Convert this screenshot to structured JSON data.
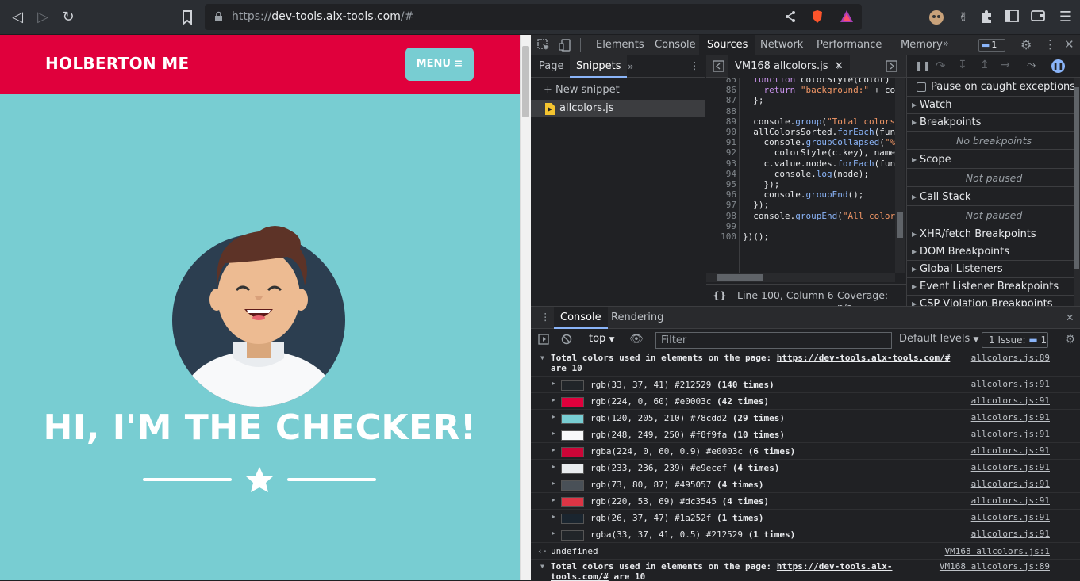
{
  "browser": {
    "url_prefix": "https://",
    "url_host": "dev-tools.alx-tools.com",
    "url_path": "/#"
  },
  "page": {
    "brand": "HOLBERTON ME",
    "menu_label": "MENU ≡",
    "hero_title": "HI, I'M THE CHECKER!",
    "colors": {
      "navbar": "#e0003c",
      "background": "#78cdd2",
      "text": "#ffffff"
    }
  },
  "devtools": {
    "tabs": [
      "Elements",
      "Console",
      "Sources",
      "Network",
      "Performance",
      "Memory"
    ],
    "active_tab": "Sources",
    "issues_count": "1",
    "navigator": {
      "tabs": [
        "Page",
        "Snippets"
      ],
      "active_tab": "Snippets",
      "new_snippet": "New snippet",
      "files": [
        "allcolors.js"
      ]
    },
    "editor": {
      "file_tab": "VM168 allcolors.js",
      "lines": [
        {
          "n": "85",
          "code": "  function colorStyle(color) {"
        },
        {
          "n": "86",
          "code": "    return \"background:\" + co"
        },
        {
          "n": "87",
          "code": "  };"
        },
        {
          "n": "88",
          "code": ""
        },
        {
          "n": "89",
          "code": "  console.group(\"Total colors"
        },
        {
          "n": "90",
          "code": "  allColorsSorted.forEach(fun"
        },
        {
          "n": "91",
          "code": "    console.groupCollapsed(\"%"
        },
        {
          "n": "92",
          "code": "      colorStyle(c.key), name"
        },
        {
          "n": "93",
          "code": "    c.value.nodes.forEach(fun"
        },
        {
          "n": "94",
          "code": "      console.log(node);"
        },
        {
          "n": "95",
          "code": "    });"
        },
        {
          "n": "96",
          "code": "    console.groupEnd();"
        },
        {
          "n": "97",
          "code": "  });"
        },
        {
          "n": "98",
          "code": "  console.groupEnd(\"All color"
        },
        {
          "n": "99",
          "code": ""
        },
        {
          "n": "100",
          "code": "})();"
        }
      ],
      "status_pretty": "{}",
      "status_position": "Line 100, Column 6",
      "status_coverage": "Coverage: n/a"
    },
    "debugger": {
      "pause_exceptions": "Pause on caught exceptions",
      "sections": [
        {
          "title": "Watch",
          "note": ""
        },
        {
          "title": "Breakpoints",
          "note": "No breakpoints"
        },
        {
          "title": "Scope",
          "note": "Not paused"
        },
        {
          "title": "Call Stack",
          "note": "Not paused"
        },
        {
          "title": "XHR/fetch Breakpoints",
          "note": ""
        },
        {
          "title": "DOM Breakpoints",
          "note": ""
        },
        {
          "title": "Global Listeners",
          "note": ""
        },
        {
          "title": "Event Listener Breakpoints",
          "note": ""
        },
        {
          "title": "CSP Violation Breakpoints",
          "note": ""
        }
      ]
    },
    "drawer": {
      "tabs": [
        "Console",
        "Rendering"
      ],
      "active_tab": "Console",
      "context": "top",
      "filter_placeholder": "Filter",
      "levels": "Default levels",
      "issues_label": "1 Issue:",
      "issues_count": "1"
    },
    "console": {
      "group1_text": "Total colors used in elements on the page: ",
      "group1_link": "https://dev-tools.alx-tools.com/#",
      "group1_tail": " are 10",
      "group1_src": "allcolors.js:89",
      "rows": [
        {
          "swatch": "#212529",
          "text": "rgb(33, 37, 41) #212529",
          "count": "(140 times)",
          "src": "allcolors.js:91"
        },
        {
          "swatch": "#e0003c",
          "text": "rgb(224, 0, 60) #e0003c",
          "count": "(42 times)",
          "src": "allcolors.js:91"
        },
        {
          "swatch": "#78cdd2",
          "text": "rgb(120, 205, 210) #78cdd2",
          "count": "(29 times)",
          "src": "allcolors.js:91"
        },
        {
          "swatch": "#f8f9fa",
          "text": "rgb(248, 249, 250) #f8f9fa",
          "count": "(10 times)",
          "src": "allcolors.js:91"
        },
        {
          "swatch": "#cc0537",
          "text": "rgba(224, 0, 60, 0.9) #e0003c",
          "count": "(6 times)",
          "src": "allcolors.js:91"
        },
        {
          "swatch": "#e9ecef",
          "text": "rgb(233, 236, 239) #e9ecef",
          "count": "(4 times)",
          "src": "allcolors.js:91"
        },
        {
          "swatch": "#495057",
          "text": "rgb(73, 80, 87) #495057",
          "count": "(4 times)",
          "src": "allcolors.js:91"
        },
        {
          "swatch": "#dc3545",
          "text": "rgb(220, 53, 69) #dc3545",
          "count": "(4 times)",
          "src": "allcolors.js:91"
        },
        {
          "swatch": "#1a252f",
          "text": "rgb(26, 37, 47) #1a252f",
          "count": "(1 times)",
          "src": "allcolors.js:91"
        },
        {
          "swatch": "#212529",
          "text": "rgba(33, 37, 41, 0.5) #212529",
          "count": "(1 times)",
          "src": "allcolors.js:91"
        }
      ],
      "undefined_text": "undefined",
      "undefined_src": "VM168 allcolors.js:1",
      "group2_text": "Total colors used in elements on the page: ",
      "group2_link": "https://dev-tools.alx-tools.com/#",
      "group2_tail": " are 10",
      "group2_src": "VM168 allcolors.js:89"
    }
  }
}
